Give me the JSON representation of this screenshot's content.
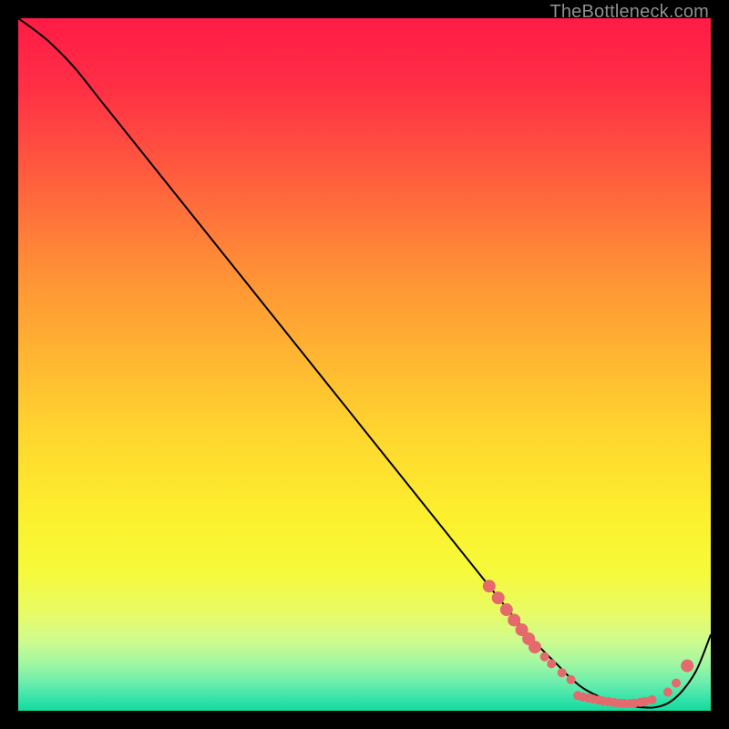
{
  "watermark": "TheBottleneck.com",
  "chart_data": {
    "type": "line",
    "title": "",
    "xlabel": "",
    "ylabel": "",
    "xlim": [
      0,
      100
    ],
    "ylim": [
      0,
      100
    ],
    "background_gradient": {
      "stops": [
        {
          "offset": 0.0,
          "color": "#ff1b46"
        },
        {
          "offset": 0.1,
          "color": "#ff2f45"
        },
        {
          "offset": 0.22,
          "color": "#ff5a3e"
        },
        {
          "offset": 0.35,
          "color": "#ff8b37"
        },
        {
          "offset": 0.48,
          "color": "#ffb332"
        },
        {
          "offset": 0.6,
          "color": "#ffd62f"
        },
        {
          "offset": 0.72,
          "color": "#fcf02e"
        },
        {
          "offset": 0.8,
          "color": "#f6fa3a"
        },
        {
          "offset": 0.86,
          "color": "#e8fb67"
        },
        {
          "offset": 0.9,
          "color": "#cdfb8e"
        },
        {
          "offset": 0.93,
          "color": "#a4f7a1"
        },
        {
          "offset": 0.96,
          "color": "#6bedad"
        },
        {
          "offset": 0.985,
          "color": "#30e2a9"
        },
        {
          "offset": 1.0,
          "color": "#14da9b"
        }
      ]
    },
    "series": [
      {
        "name": "curve",
        "color": "#000000",
        "x": [
          0,
          4,
          8,
          12,
          20,
          30,
          40,
          50,
          60,
          68,
          72,
          75,
          78,
          80,
          82,
          85,
          88,
          90,
          92,
          94,
          96,
          98,
          100
        ],
        "y": [
          100,
          97,
          93,
          88,
          78,
          65.5,
          53,
          40.5,
          28,
          18,
          13,
          9.5,
          6.5,
          4.5,
          3,
          1.6,
          0.8,
          0.5,
          0.5,
          1.2,
          3.0,
          6.0,
          11
        ]
      }
    ],
    "markers": {
      "color": "#e46a6e",
      "radius_small": 5,
      "radius_large": 7,
      "points": [
        {
          "x": 68.0,
          "y": 18.0,
          "r": "large"
        },
        {
          "x": 69.3,
          "y": 16.3,
          "r": "large"
        },
        {
          "x": 70.5,
          "y": 14.6,
          "r": "large"
        },
        {
          "x": 71.6,
          "y": 13.1,
          "r": "large"
        },
        {
          "x": 72.7,
          "y": 11.7,
          "r": "large"
        },
        {
          "x": 73.7,
          "y": 10.4,
          "r": "large"
        },
        {
          "x": 74.6,
          "y": 9.2,
          "r": "large"
        },
        {
          "x": 76.0,
          "y": 7.8,
          "r": "small"
        },
        {
          "x": 77.0,
          "y": 6.8,
          "r": "small"
        },
        {
          "x": 78.5,
          "y": 5.5,
          "r": "small"
        },
        {
          "x": 79.8,
          "y": 4.5,
          "r": "small"
        },
        {
          "x": 80.8,
          "y": 2.2,
          "r": "small"
        },
        {
          "x": 81.5,
          "y": 2.0,
          "r": "small"
        },
        {
          "x": 82.3,
          "y": 1.85,
          "r": "small"
        },
        {
          "x": 83.0,
          "y": 1.7,
          "r": "small"
        },
        {
          "x": 83.8,
          "y": 1.55,
          "r": "small"
        },
        {
          "x": 84.5,
          "y": 1.4,
          "r": "small"
        },
        {
          "x": 85.3,
          "y": 1.3,
          "r": "small"
        },
        {
          "x": 86.0,
          "y": 1.2,
          "r": "small"
        },
        {
          "x": 86.8,
          "y": 1.1,
          "r": "small"
        },
        {
          "x": 87.5,
          "y": 1.05,
          "r": "small"
        },
        {
          "x": 88.3,
          "y": 1.05,
          "r": "small"
        },
        {
          "x": 89.0,
          "y": 1.1,
          "r": "small"
        },
        {
          "x": 89.8,
          "y": 1.2,
          "r": "small"
        },
        {
          "x": 90.5,
          "y": 1.35,
          "r": "small"
        },
        {
          "x": 91.5,
          "y": 1.6,
          "r": "small"
        },
        {
          "x": 93.8,
          "y": 2.7,
          "r": "small"
        },
        {
          "x": 95.0,
          "y": 4.0,
          "r": "small"
        },
        {
          "x": 96.6,
          "y": 6.5,
          "r": "large"
        }
      ]
    }
  }
}
